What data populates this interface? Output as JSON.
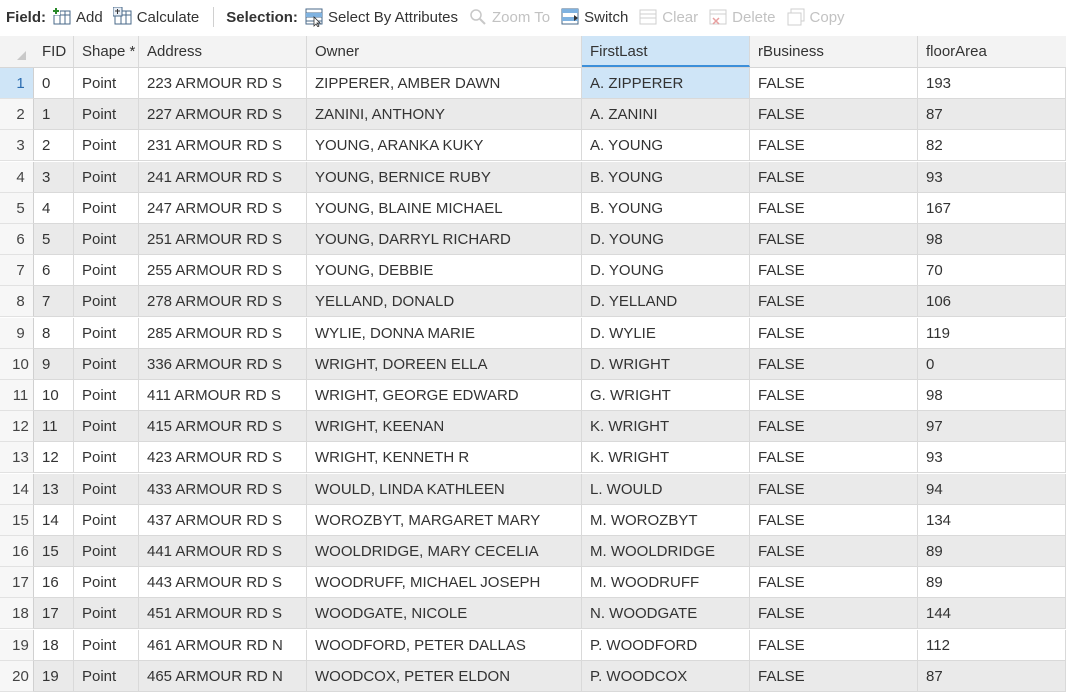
{
  "toolbar": {
    "field_label": "Field:",
    "add_label": "Add",
    "calculate_label": "Calculate",
    "selection_label": "Selection:",
    "select_by_attributes_label": "Select By Attributes",
    "zoom_to_label": "Zoom To",
    "switch_label": "Switch",
    "clear_label": "Clear",
    "delete_label": "Delete",
    "copy_label": "Copy"
  },
  "table": {
    "columns": [
      "FID",
      "Shape *",
      "Address",
      "Owner",
      "FirstLast",
      "rBusiness",
      "floorArea"
    ],
    "selected_column": "FirstLast",
    "rows": [
      {
        "n": "1",
        "fid": "0",
        "shape": "Point",
        "address": "223 ARMOUR RD S",
        "owner": "ZIPPERER, AMBER DAWN",
        "firstlast": "A. ZIPPERER",
        "rbusiness": "FALSE",
        "floorarea": "193"
      },
      {
        "n": "2",
        "fid": "1",
        "shape": "Point",
        "address": "227 ARMOUR RD S",
        "owner": "ZANINI, ANTHONY",
        "firstlast": "A. ZANINI",
        "rbusiness": "FALSE",
        "floorarea": "87"
      },
      {
        "n": "3",
        "fid": "2",
        "shape": "Point",
        "address": "231 ARMOUR RD S",
        "owner": "YOUNG, ARANKA KUKY",
        "firstlast": "A. YOUNG",
        "rbusiness": "FALSE",
        "floorarea": "82"
      },
      {
        "n": "4",
        "fid": "3",
        "shape": "Point",
        "address": "241 ARMOUR RD S",
        "owner": "YOUNG, BERNICE RUBY",
        "firstlast": "B. YOUNG",
        "rbusiness": "FALSE",
        "floorarea": "93"
      },
      {
        "n": "5",
        "fid": "4",
        "shape": "Point",
        "address": "247 ARMOUR RD S",
        "owner": "YOUNG, BLAINE MICHAEL",
        "firstlast": "B. YOUNG",
        "rbusiness": "FALSE",
        "floorarea": "167"
      },
      {
        "n": "6",
        "fid": "5",
        "shape": "Point",
        "address": "251 ARMOUR RD S",
        "owner": "YOUNG, DARRYL RICHARD",
        "firstlast": "D. YOUNG",
        "rbusiness": "FALSE",
        "floorarea": "98"
      },
      {
        "n": "7",
        "fid": "6",
        "shape": "Point",
        "address": "255 ARMOUR RD S",
        "owner": "YOUNG, DEBBIE",
        "firstlast": "D. YOUNG",
        "rbusiness": "FALSE",
        "floorarea": "70"
      },
      {
        "n": "8",
        "fid": "7",
        "shape": "Point",
        "address": "278 ARMOUR RD S",
        "owner": "YELLAND, DONALD",
        "firstlast": "D. YELLAND",
        "rbusiness": "FALSE",
        "floorarea": "106"
      },
      {
        "n": "9",
        "fid": "8",
        "shape": "Point",
        "address": "285 ARMOUR RD S",
        "owner": "WYLIE, DONNA MARIE",
        "firstlast": "D. WYLIE",
        "rbusiness": "FALSE",
        "floorarea": "119"
      },
      {
        "n": "10",
        "fid": "9",
        "shape": "Point",
        "address": "336 ARMOUR RD S",
        "owner": "WRIGHT, DOREEN ELLA",
        "firstlast": "D. WRIGHT",
        "rbusiness": "FALSE",
        "floorarea": "0"
      },
      {
        "n": "11",
        "fid": "10",
        "shape": "Point",
        "address": "411 ARMOUR RD S",
        "owner": "WRIGHT, GEORGE EDWARD",
        "firstlast": "G. WRIGHT",
        "rbusiness": "FALSE",
        "floorarea": "98"
      },
      {
        "n": "12",
        "fid": "11",
        "shape": "Point",
        "address": "415 ARMOUR RD S",
        "owner": "WRIGHT, KEENAN",
        "firstlast": "K. WRIGHT",
        "rbusiness": "FALSE",
        "floorarea": "97"
      },
      {
        "n": "13",
        "fid": "12",
        "shape": "Point",
        "address": "423 ARMOUR RD S",
        "owner": "WRIGHT, KENNETH R",
        "firstlast": "K. WRIGHT",
        "rbusiness": "FALSE",
        "floorarea": "93"
      },
      {
        "n": "14",
        "fid": "13",
        "shape": "Point",
        "address": "433 ARMOUR RD S",
        "owner": "WOULD, LINDA KATHLEEN",
        "firstlast": "L. WOULD",
        "rbusiness": "FALSE",
        "floorarea": "94"
      },
      {
        "n": "15",
        "fid": "14",
        "shape": "Point",
        "address": "437 ARMOUR RD S",
        "owner": "WOROZBYT, MARGARET MARY",
        "firstlast": "M. WOROZBYT",
        "rbusiness": "FALSE",
        "floorarea": "134"
      },
      {
        "n": "16",
        "fid": "15",
        "shape": "Point",
        "address": "441 ARMOUR RD S",
        "owner": "WOOLDRIDGE, MARY  CECELIA",
        "firstlast": "M. WOOLDRIDGE",
        "rbusiness": "FALSE",
        "floorarea": "89"
      },
      {
        "n": "17",
        "fid": "16",
        "shape": "Point",
        "address": "443 ARMOUR RD S",
        "owner": "WOODRUFF, MICHAEL JOSEPH",
        "firstlast": "M. WOODRUFF",
        "rbusiness": "FALSE",
        "floorarea": "89"
      },
      {
        "n": "18",
        "fid": "17",
        "shape": "Point",
        "address": "451 ARMOUR RD S",
        "owner": "WOODGATE, NICOLE",
        "firstlast": "N. WOODGATE",
        "rbusiness": "FALSE",
        "floorarea": "144"
      },
      {
        "n": "19",
        "fid": "18",
        "shape": "Point",
        "address": "461 ARMOUR RD N",
        "owner": "WOODFORD, PETER DALLAS",
        "firstlast": "P. WOODFORD",
        "rbusiness": "FALSE",
        "floorarea": "112"
      },
      {
        "n": "20",
        "fid": "19",
        "shape": "Point",
        "address": "465 ARMOUR RD N",
        "owner": "WOODCOX, PETER ELDON",
        "firstlast": "P. WOODCOX",
        "rbusiness": "FALSE",
        "floorarea": "87"
      }
    ]
  }
}
